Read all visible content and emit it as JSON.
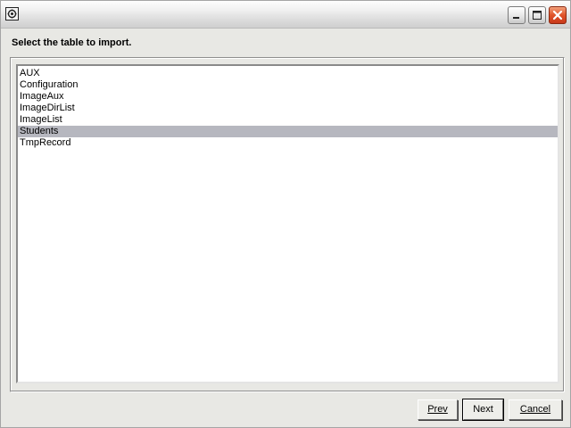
{
  "window": {
    "title": "",
    "controls": {
      "minimize": "minimize-icon",
      "maximize": "maximize-icon",
      "close": "close-icon"
    }
  },
  "instruction": "Select the table to import.",
  "tables": {
    "items": [
      "AUX",
      "Configuration",
      "ImageAux",
      "ImageDirList",
      "ImageList",
      "Students",
      "TmpRecord"
    ],
    "selected": "Students"
  },
  "buttons": {
    "prev_label": "Prev",
    "next_label": "Next",
    "cancel_label": "Cancel"
  },
  "colors": {
    "selection": "#b6b7bf",
    "window_bg": "#e8e8e4",
    "close_button": "#e0542a"
  }
}
